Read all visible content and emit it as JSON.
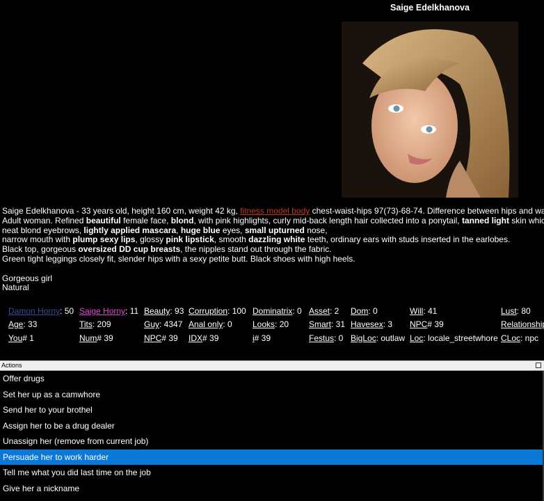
{
  "character": {
    "name": "Saige Edelkhanova"
  },
  "description": {
    "line1_a": "Saige Edelkhanova - 33 years old, height 160 cm, weight 42 kg, ",
    "line1_link": "fitness model body",
    "line1_b": " chest-waist-hips 97(73)-68-74. Difference between hips and waist is",
    "line2_a": "Adult woman. Refined ",
    "line2_b1": "beautiful",
    "line2_c": " female face, ",
    "line2_b2": "blond",
    "line2_d": ", with pink highlights, curly mid-back length hair collected into a ponytail, ",
    "line2_b3": "tanned light",
    "line2_e": " skin which",
    "line3_a": "neat blond eyebrows, ",
    "line3_b1": "lightly applied mascara",
    "line3_c": ", ",
    "line3_b2": "huge blue",
    "line3_d": " eyes, ",
    "line3_b3": "small upturned",
    "line3_e": " nose,",
    "line4_a": "narrow mouth with ",
    "line4_b1": "plump sexy lips",
    "line4_c": ", glossy ",
    "line4_b2": "pink lipstick",
    "line4_d": ", smooth ",
    "line4_b3": "dazzling white",
    "line4_e": " teeth, ordinary ears with studs inserted in the earlobes.",
    "line5_a": "Black top, gorgeous ",
    "line5_b1": "oversized DD cup breasts",
    "line5_c": ", the nipples stand out through the fabric.",
    "line6": "Green tight leggings closely fit, slender hips with a sexy petite butt. Black shoes with high heels.",
    "tag1": "Gorgeous girl",
    "tag2": "Natural"
  },
  "stats": {
    "damon_horny": {
      "label": "Damon Horny",
      "value": ": 50"
    },
    "saige_horny": {
      "label": "Saige Horny",
      "value": ": 11"
    },
    "beauty": {
      "label": "Beauty",
      "value": ": 93"
    },
    "corruption": {
      "label": "Corruption",
      "value": ": 100"
    },
    "dominatrix": {
      "label": "Dominatrix",
      "value": ": 0"
    },
    "asset": {
      "label": "Asset",
      "value": ": 2"
    },
    "dom": {
      "label": "Dom",
      "value": ": 0"
    },
    "will": {
      "label": "Will",
      "value": ": 41"
    },
    "lust": {
      "label": "Lust",
      "value": ": 80"
    },
    "age": {
      "label": "Age",
      "value": ": 33"
    },
    "tits": {
      "label": "Tits",
      "value": ": 209"
    },
    "guy": {
      "label": "Guy",
      "value": ": 4347"
    },
    "anal_only": {
      "label": "Anal only",
      "value": ": 0"
    },
    "looks": {
      "label": "Looks",
      "value": ": 20"
    },
    "smart": {
      "label": "Smart",
      "value": ": 31"
    },
    "havesex": {
      "label": "Havesex",
      "value": ": 3"
    },
    "npc1": {
      "label": "NPC",
      "value": "# 39"
    },
    "relationship": {
      "label": "Relationship",
      "value": ""
    },
    "you": {
      "label": "You",
      "value": "# 1"
    },
    "num": {
      "label": "Num",
      "value": "# 39"
    },
    "npc2": {
      "label": "NPC",
      "value": "# 39"
    },
    "idx": {
      "label": "IDX",
      "value": "# 39"
    },
    "i": {
      "label": "i",
      "value": "# 39"
    },
    "festus": {
      "label": "Festus",
      "value": ": 0"
    },
    "bigloc": {
      "label": "BigLoc",
      "value": ": outlaw"
    },
    "loc": {
      "label": "Loc",
      "value": ": locale_streetwhore"
    },
    "cloc": {
      "label": "CLoc",
      "value": ": npc"
    }
  },
  "actions_panel": {
    "title": "Actions",
    "items": [
      "Offer drugs",
      "Set her up as a camwhore",
      "Send her to your brothel",
      "Assign her to be a drug dealer",
      "Unassign her (remove from current job)",
      "Persuade her to work harder",
      "Tell me what you did last time on the job",
      "Give her a nickname"
    ],
    "selected_index": 5
  },
  "colors": {
    "selection": "#0a78d7",
    "link_red": "#c0392b",
    "label_blue": "#3d4b99",
    "label_pink": "#e04dd3"
  }
}
